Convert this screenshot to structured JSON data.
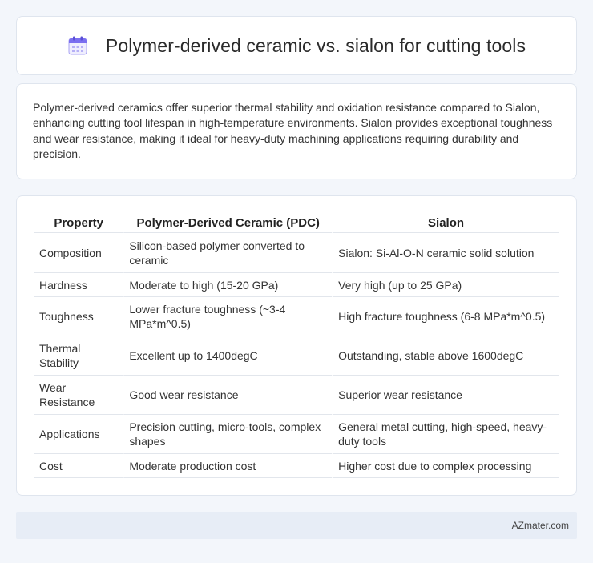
{
  "header": {
    "title": "Polymer-derived ceramic vs. sialon for cutting tools",
    "icon": "calendar-icon"
  },
  "summary": {
    "text": "Polymer-derived ceramics offer superior thermal stability and oxidation resistance compared to Sialon, enhancing cutting tool lifespan in high-temperature environments. Sialon provides exceptional toughness and wear resistance, making it ideal for heavy-duty machining applications requiring durability and precision."
  },
  "table": {
    "headers": [
      "Property",
      "Polymer-Derived Ceramic (PDC)",
      "Sialon"
    ],
    "rows": [
      [
        "Composition",
        "Silicon-based polymer converted to ceramic",
        "Sialon: Si-Al-O-N ceramic solid solution"
      ],
      [
        "Hardness",
        "Moderate to high (15-20 GPa)",
        "Very high (up to 25 GPa)"
      ],
      [
        "Toughness",
        "Lower fracture toughness (~3-4 MPa*m^0.5)",
        "High fracture toughness (6-8 MPa*m^0.5)"
      ],
      [
        "Thermal Stability",
        "Excellent up to 1400degC",
        "Outstanding, stable above 1600degC"
      ],
      [
        "Wear Resistance",
        "Good wear resistance",
        "Superior wear resistance"
      ],
      [
        "Applications",
        "Precision cutting, micro-tools, complex shapes",
        "General metal cutting, high-speed, heavy-duty tools"
      ],
      [
        "Cost",
        "Moderate production cost",
        "Higher cost due to complex processing"
      ]
    ]
  },
  "footer": {
    "brand": "AZmater.com"
  },
  "colors": {
    "background": "#f3f6fb",
    "card": "#ffffff",
    "footer": "#e7edf6",
    "icon_accent": "#7b6ff0"
  }
}
